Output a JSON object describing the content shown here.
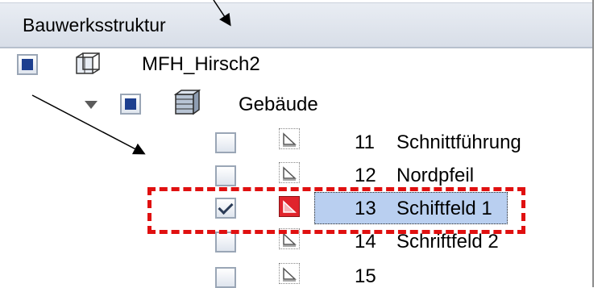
{
  "panel": {
    "title": "Bauwerksstruktur"
  },
  "tree": {
    "root": {
      "label": "MFH_Hirsch2",
      "icon": "structure-icon",
      "checkbox": "filled"
    },
    "building": {
      "label": "Gebäude",
      "icon": "building-icon",
      "checkbox": "filled",
      "expander": "chevron-down-icon"
    },
    "items": [
      {
        "number": "11",
        "label": "Schnittführung",
        "icon": "layer-icon",
        "checked": false,
        "selected": false
      },
      {
        "number": "12",
        "label": "Nordpfeil",
        "icon": "layer-icon",
        "checked": false,
        "selected": false
      },
      {
        "number": "13",
        "label": "Schiftfeld 1",
        "icon": "layer-icon-active",
        "checked": true,
        "selected": true
      },
      {
        "number": "14",
        "label": "Schriftfeld 2",
        "icon": "layer-icon",
        "checked": false,
        "selected": false
      },
      {
        "number": "15",
        "label": "",
        "icon": "layer-icon",
        "checked": false,
        "selected": false
      }
    ]
  },
  "colors": {
    "highlight": "#b9cff0",
    "annotation_red": "#e01010",
    "checkbox_fill": "#1d3f8f"
  }
}
